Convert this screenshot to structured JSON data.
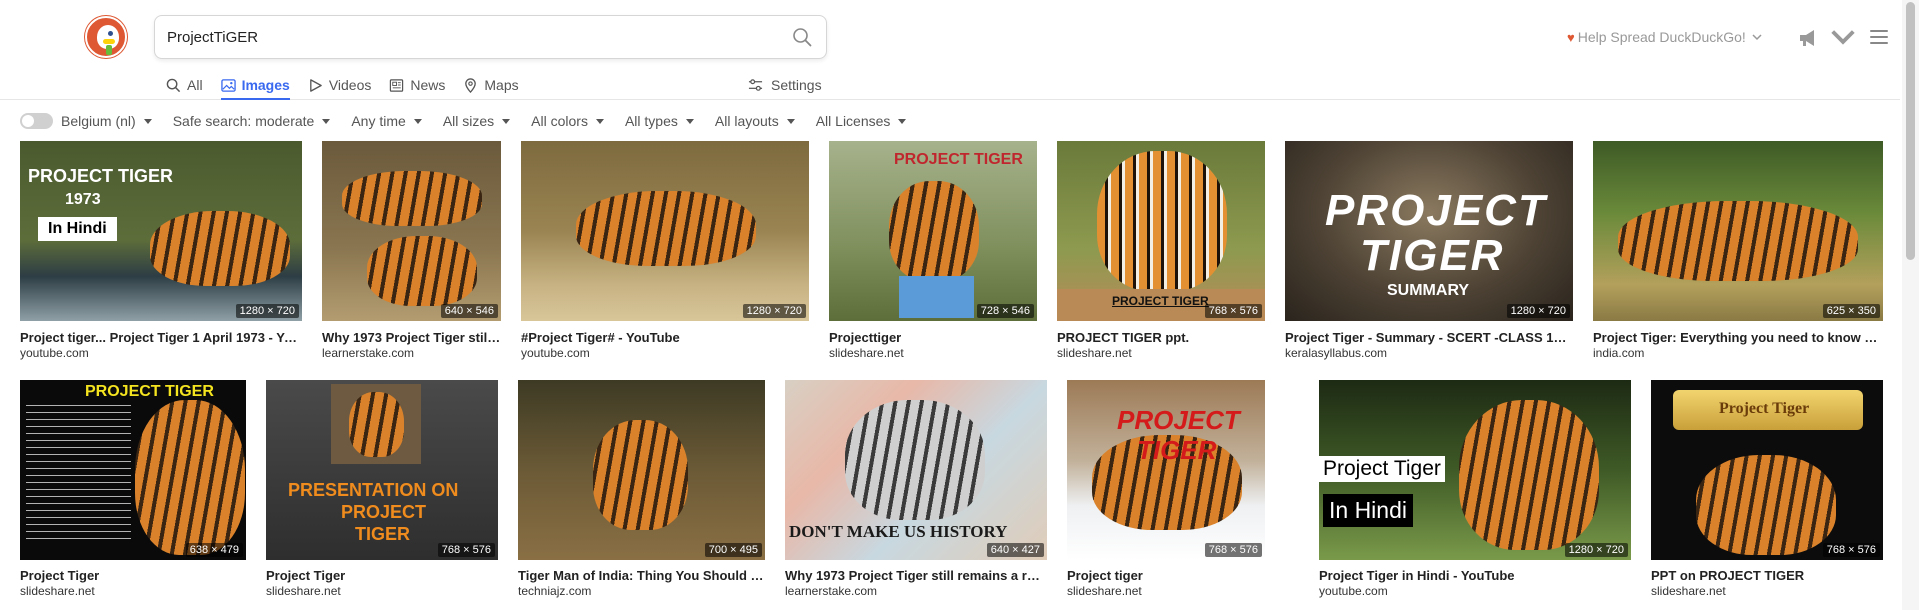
{
  "search": {
    "query": "ProjectTiGER"
  },
  "tabs": [
    {
      "label": "All",
      "icon": "search-icon",
      "active": false
    },
    {
      "label": "Images",
      "icon": "image-icon",
      "active": true
    },
    {
      "label": "Videos",
      "icon": "play-icon",
      "active": false
    },
    {
      "label": "News",
      "icon": "newspaper-icon",
      "active": false
    },
    {
      "label": "Maps",
      "icon": "map-pin-icon",
      "active": false
    }
  ],
  "settings_label": "Settings",
  "header": {
    "spread_label": "Help Spread DuckDuckGo!"
  },
  "filters": {
    "region": "Belgium (nl)",
    "safe_search": "Safe search: moderate",
    "time": "Any time",
    "size": "All sizes",
    "color": "All colors",
    "type": "All types",
    "layout": "All layouts",
    "license": "All Licenses"
  },
  "results_row1": [
    {
      "title": "Project tiger... Project Tiger 1 April 1973 - YouT...",
      "source": "youtube.com",
      "dims": "1280 × 720",
      "overlay": [
        "PROJECT TIGER",
        "1973",
        "In Hindi"
      ]
    },
    {
      "title": "Why 1973 Project Tiger still ...",
      "source": "learnerstake.com",
      "dims": "640 × 546"
    },
    {
      "title": "#Project Tiger# - YouTube",
      "source": "youtube.com",
      "dims": "1280 × 720"
    },
    {
      "title": "Projecttiger",
      "source": "slideshare.net",
      "dims": "728 × 546",
      "overlay": [
        "PROJECT TIGER"
      ]
    },
    {
      "title": "PROJECT TIGER ppt.",
      "source": "slideshare.net",
      "dims": "768 × 576",
      "overlay": [
        "PROJECT TIGER"
      ]
    },
    {
      "title": "Project Tiger - Summary - SCERT -CLASS 10-S...",
      "source": "keralasyllabus.com",
      "dims": "1280 × 720",
      "overlay": [
        "PROJECT",
        "TIGER",
        "SUMMARY"
      ]
    },
    {
      "title": "Project Tiger: Everything you need to know ab...",
      "source": "india.com",
      "dims": "625 × 350"
    }
  ],
  "results_row2": [
    {
      "title": "Project Tiger",
      "source": "slideshare.net",
      "dims": "638 × 479",
      "overlay": [
        "PROJECT TIGER"
      ]
    },
    {
      "title": "Project Tiger",
      "source": "slideshare.net",
      "dims": "768 × 576",
      "overlay": [
        "PRESENTATION ON",
        "PROJECT",
        "TIGER"
      ]
    },
    {
      "title": "Tiger Man of India: Thing You Should K...",
      "source": "techniajz.com",
      "dims": "700 × 495"
    },
    {
      "title": "Why 1973 Project Tiger still remains a rem...",
      "source": "learnerstake.com",
      "dims": "640 × 427",
      "overlay": [
        "DON'T MAKE US HISTORY"
      ]
    },
    {
      "title": "Project tiger",
      "source": "slideshare.net",
      "dims": "768 × 576",
      "overlay": [
        "PROJECT",
        "TIGER"
      ]
    },
    {
      "title": "Project Tiger in Hindi - YouTube",
      "source": "youtube.com",
      "dims": "1280 × 720",
      "overlay": [
        "Project Tiger",
        "In Hindi"
      ]
    },
    {
      "title": "PPT on PROJECT TIGER",
      "source": "slideshare.net",
      "dims": "768 × 576",
      "overlay": [
        "Project Tiger"
      ]
    }
  ],
  "colors": {
    "accent": "#3969ef",
    "brand": "#de5833"
  }
}
